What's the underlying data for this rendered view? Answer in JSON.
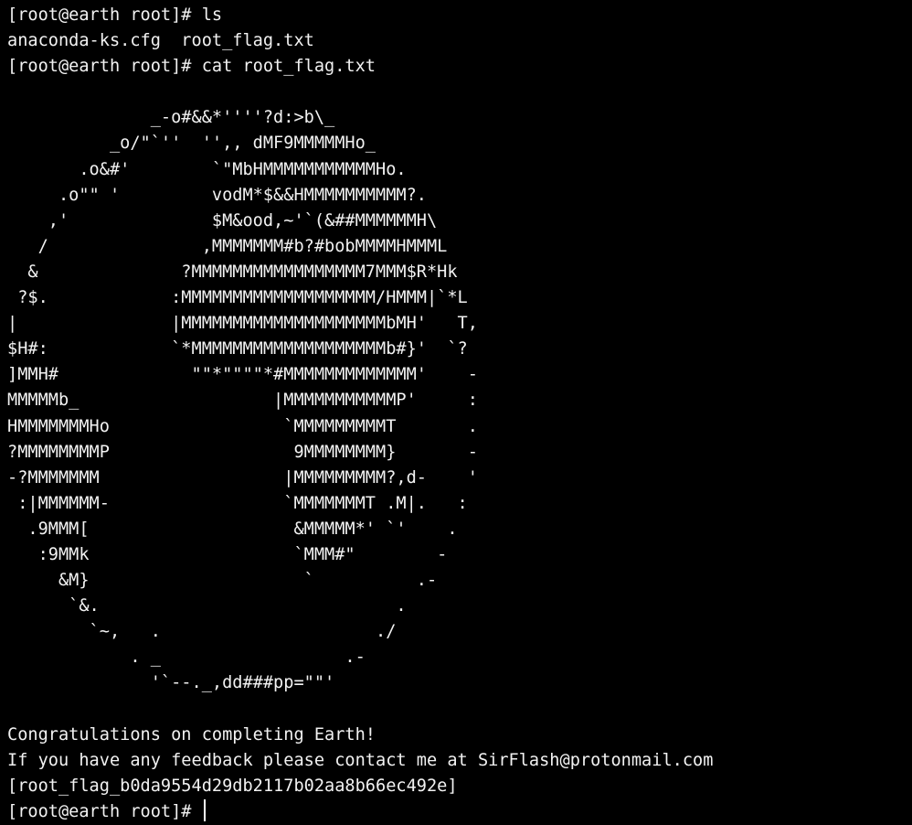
{
  "terminal": {
    "background": "#000000",
    "foreground": "#f2f2f2",
    "lines": [
      "[root@earth root]# ls",
      "anaconda-ks.cfg  root_flag.txt",
      "[root@earth root]# cat root_flag.txt",
      "",
      "              _-o#&&*''''?d:>b\\_",
      "          _o/\"`''  '',, dMF9MMMMMHo_",
      "       .o&#'        `\"MbHMMMMMMMMMMMHo.",
      "     .o\"\" '         vodM*$&&HMMMMMMMMMM?.",
      "    ,'              $M&ood,~'`(&##MMMMMMH\\",
      "   /               ,MMMMMMM#b?#bobMMMMHMMML",
      "  &              ?MMMMMMMMMMMMMMMMM7MMM$R*Hk",
      " ?$.            :MMMMMMMMMMMMMMMMMMM/HMMM|`*L",
      "|               |MMMMMMMMMMMMMMMMMMMMbMH'   T,",
      "$H#:            `*MMMMMMMMMMMMMMMMMMMb#}'  `?",
      "]MMH#             \"\"*\"\"\"\"*#MMMMMMMMMMMMM'    -",
      "MMMMMb_                   |MMMMMMMMMMMP'     :",
      "HMMMMMMMHo                 `MMMMMMMMMT       .",
      "?MMMMMMMMP                  9MMMMMMMM}       -",
      "-?MMMMMMM                  |MMMMMMMMM?,d-    '",
      " :|MMMMMM-                 `MMMMMMMT .M|.   :",
      "  .9MMM[                    &MMMMM*' `'    .",
      "   :9MMk                    `MMM#\"        -",
      "     &M}                     `          .-",
      "      `&.                             .",
      "        `~,   .                     ./",
      "            . _                  .-",
      "              '`--._,dd###pp=\"\"'",
      "",
      "Congratulations on completing Earth!",
      "If you have any feedback please contact me at SirFlash@protonmail.com",
      "[root_flag_b0da9554d29db2117b02aa8b66ec492e]"
    ],
    "prompt": "[root@earth root]# "
  }
}
